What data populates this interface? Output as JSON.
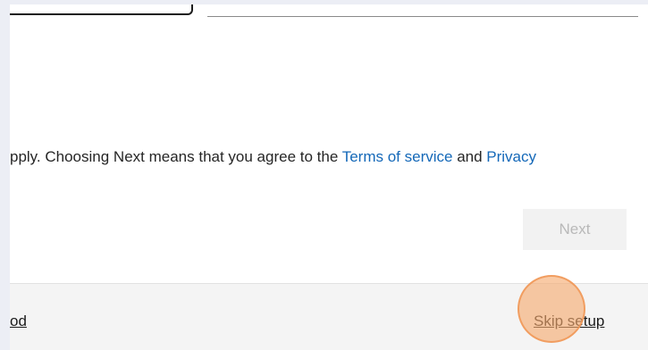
{
  "consent": {
    "text_before": "pply. Choosing Next means that you agree to the ",
    "terms_link": "Terms of service",
    "text_middle": " and ",
    "privacy_link": "Privacy"
  },
  "actions": {
    "next_label": "Next",
    "next_enabled": false
  },
  "footer": {
    "left_link_fragment": "od",
    "skip_label": "Skip setup"
  },
  "colors": {
    "link": "#1468b8",
    "disabled_button_bg": "#f2f2f2",
    "click_marker": "#f6aa6e"
  }
}
